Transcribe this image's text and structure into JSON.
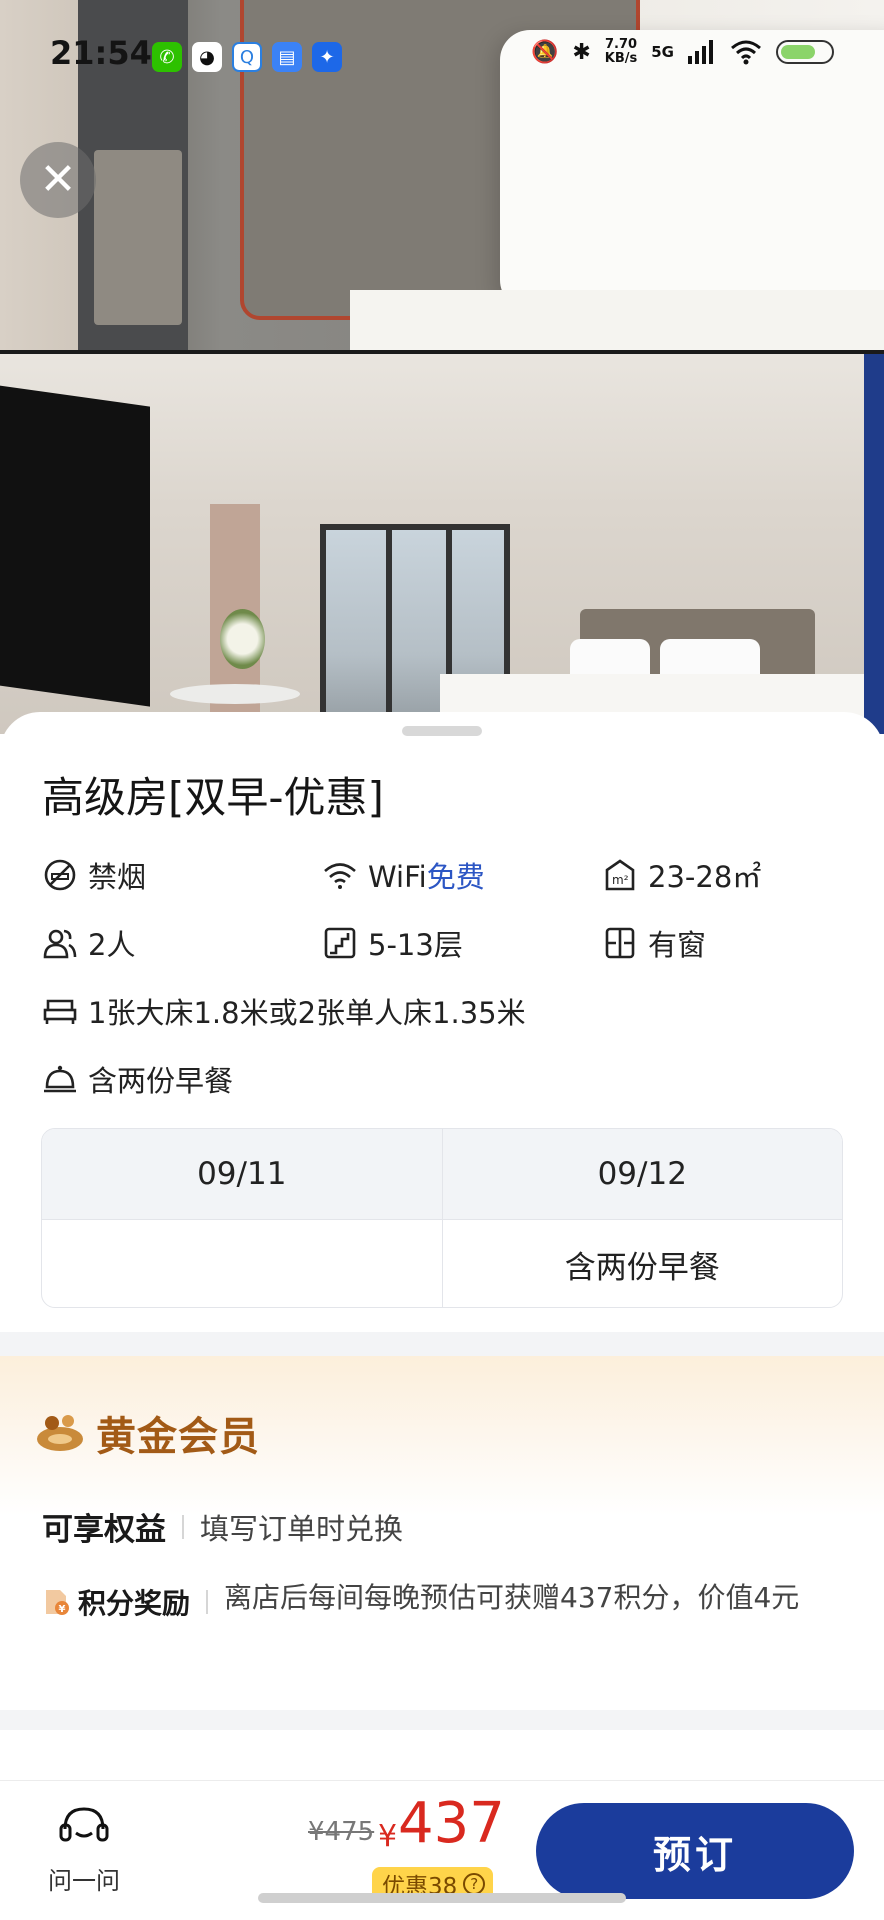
{
  "status_bar": {
    "time": "21:54",
    "network_speed_value": "7.70",
    "network_speed_unit": "KB/s",
    "signal": "5G",
    "app_icons": [
      "wechat-icon",
      "qq-icon",
      "qq-browser-icon",
      "file-icon",
      "app-icon"
    ]
  },
  "room": {
    "title": "高级房[双早-优惠]",
    "amenities": {
      "smoking": "禁烟",
      "wifi_label": "WiFi",
      "wifi_value": "免费",
      "area": "23-28㎡",
      "occupancy": "2人",
      "floor": "5-13层",
      "window": "有窗",
      "bed": "1张大床1.8米或2张单人床1.35米",
      "breakfast": "含两份早餐"
    },
    "dates": {
      "headers": [
        "09/11",
        "09/12"
      ],
      "values": [
        "",
        "含两份早餐"
      ]
    }
  },
  "membership": {
    "title": "黄金会员",
    "benefits_title": "可享权益",
    "benefits_note": "填写订单时兑换",
    "points_label": "积分奖励",
    "points_text": "离店后每间每晚预估可获赠437积分，价值4元"
  },
  "bottom_bar": {
    "ask_label": "问一问",
    "old_price": "¥475",
    "currency": "¥",
    "price": "437",
    "discount_label": "优惠38",
    "book_label": "预订"
  },
  "colors": {
    "accent_blue": "#1b3c9c",
    "price_red": "#d9291f",
    "gold": "#a25a16",
    "discount_yellow": "#ffd44a",
    "link_blue": "#2c56c4"
  }
}
